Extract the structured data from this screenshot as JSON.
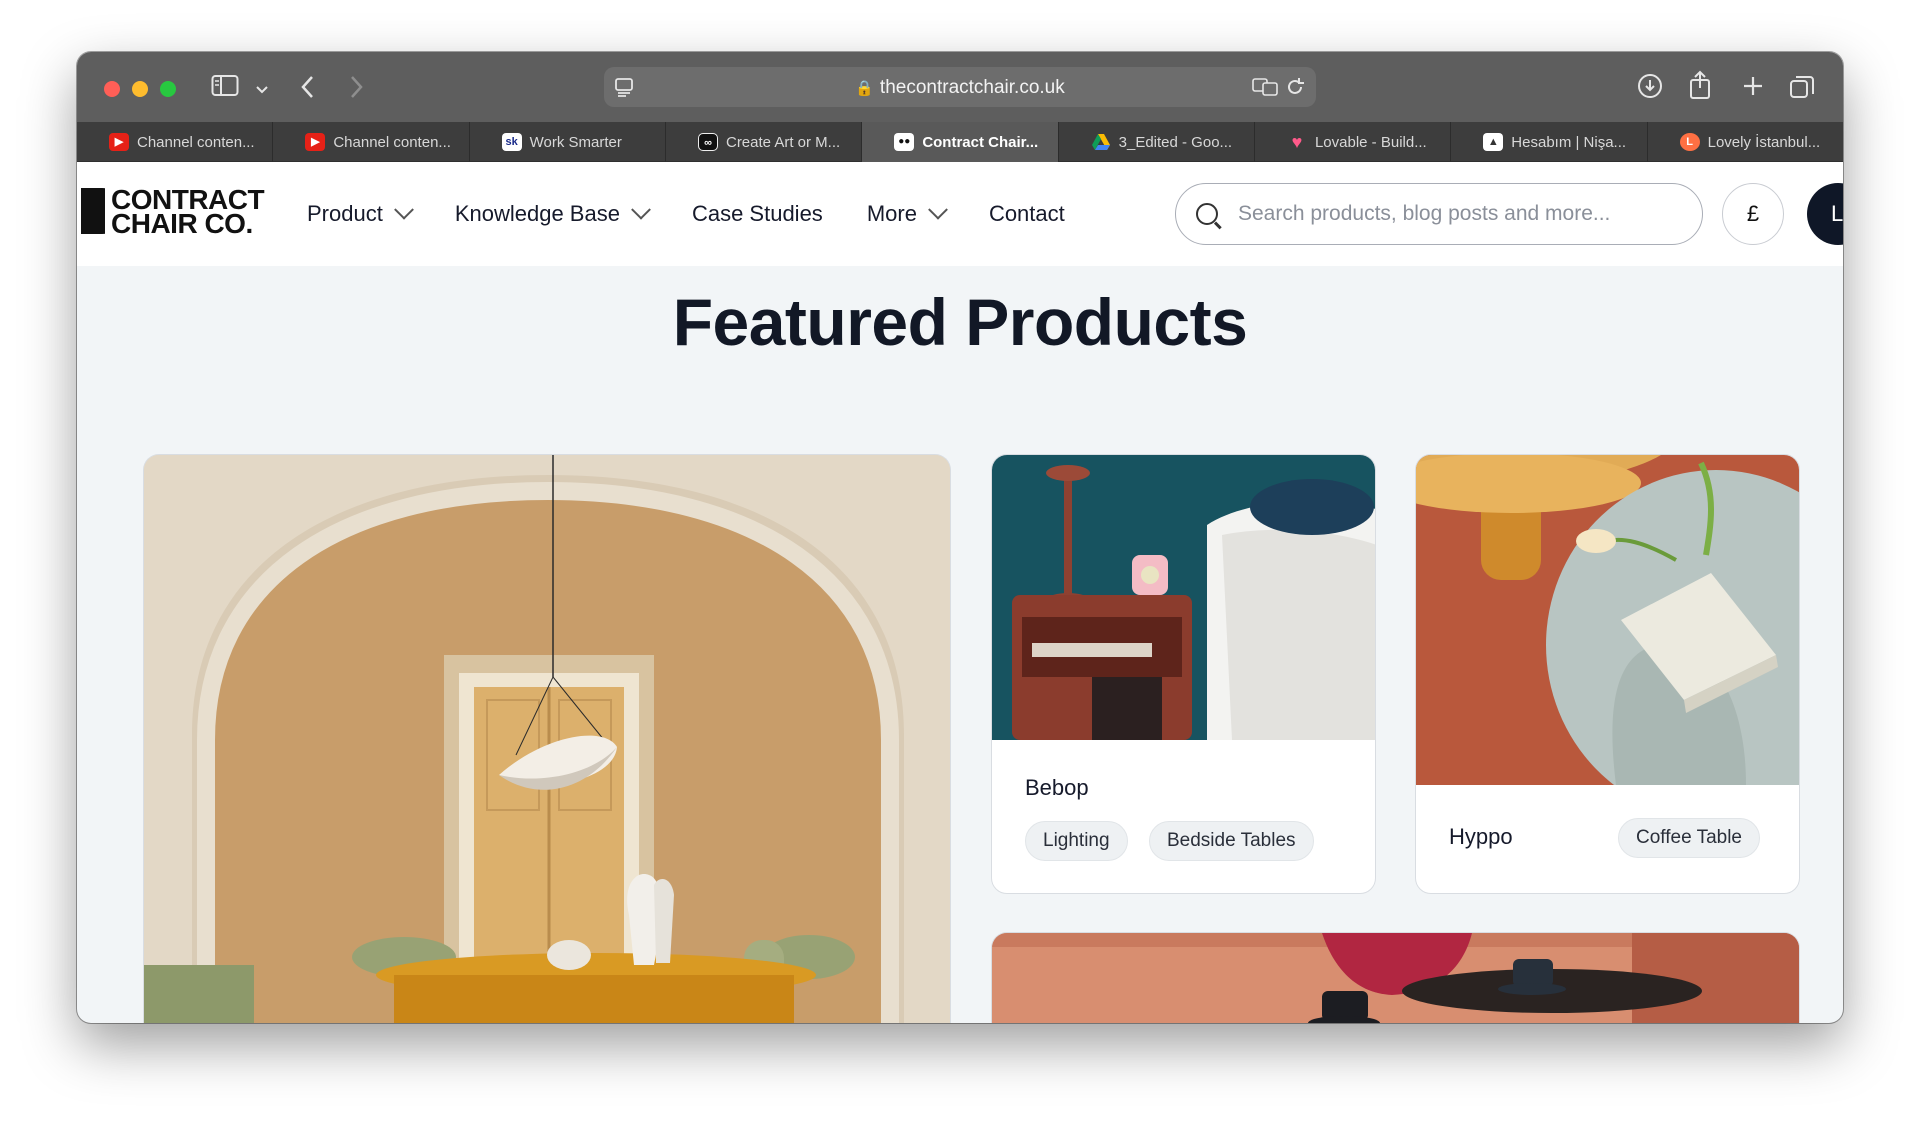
{
  "browser": {
    "url": "thecontractchair.co.uk",
    "tabs": [
      {
        "label": "Channel conten...",
        "favicon": "youtube-icon",
        "color": "#e62117"
      },
      {
        "label": "Channel conten...",
        "favicon": "youtube-icon",
        "color": "#e62117"
      },
      {
        "label": "Work Smarter",
        "favicon": "sk-icon",
        "color": "#ffffff",
        "text": "sk"
      },
      {
        "label": "Create Art or M...",
        "favicon": "infinity-icon",
        "color": "#111111"
      },
      {
        "label": "Contract Chair...",
        "favicon": "contract-chair-icon",
        "color": "#111111",
        "active": true
      },
      {
        "label": "3_Edited - Goo...",
        "favicon": "google-drive-icon",
        "color": "#fbbc04"
      },
      {
        "label": "Lovable - Build...",
        "favicon": "heart-icon",
        "color": "#ff5a8a"
      },
      {
        "label": "Hesabım | Nişa...",
        "favicon": "account-icon",
        "color": "#ffffff"
      },
      {
        "label": "Lovely İstanbul...",
        "favicon": "lovely-icon",
        "color": "#ff7043"
      }
    ]
  },
  "site": {
    "logo_line1": "CONTRACT",
    "logo_line2": "CHAIR CO.",
    "nav": [
      {
        "label": "Product",
        "dropdown": true
      },
      {
        "label": "Knowledge Base",
        "dropdown": true
      },
      {
        "label": "Case Studies",
        "dropdown": false
      },
      {
        "label": "More",
        "dropdown": true
      },
      {
        "label": "Contact",
        "dropdown": false
      }
    ],
    "search_placeholder": "Search products, blog posts and more...",
    "currency": "£",
    "account_initial": "L"
  },
  "main": {
    "heading": "Featured Products",
    "products": [
      {
        "name": "Bebop",
        "tags": [
          "Lighting",
          "Bedside Tables"
        ]
      },
      {
        "name": "Hyppo",
        "tags": [
          "Coffee Table"
        ]
      }
    ]
  }
}
